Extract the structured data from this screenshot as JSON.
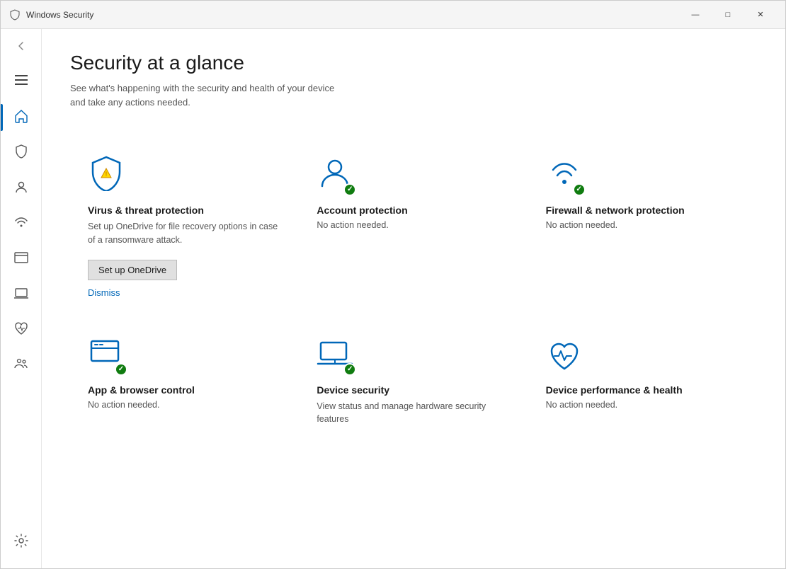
{
  "window": {
    "title": "Windows Security",
    "controls": {
      "minimize": "—",
      "maximize": "□",
      "close": "✕"
    }
  },
  "page": {
    "title": "Security at a glance",
    "subtitle": "See what's happening with the security and health of your device\nand take any actions needed."
  },
  "nav": {
    "items": [
      {
        "id": "home",
        "label": "Home",
        "active": true
      },
      {
        "id": "virus",
        "label": "Virus & threat protection",
        "active": false
      },
      {
        "id": "account",
        "label": "Account protection",
        "active": false
      },
      {
        "id": "firewall",
        "label": "Firewall & network protection",
        "active": false
      },
      {
        "id": "app",
        "label": "App & browser control",
        "active": false
      },
      {
        "id": "device",
        "label": "Device security",
        "active": false
      },
      {
        "id": "health",
        "label": "Device performance & health",
        "active": false
      },
      {
        "id": "family",
        "label": "Family options",
        "active": false
      }
    ],
    "settings_label": "Settings"
  },
  "cards": [
    {
      "id": "virus",
      "title": "Virus & threat protection",
      "description": "Set up OneDrive for file recovery options in case of a ransomware attack.",
      "status": "",
      "has_warning": true,
      "button_label": "Set up OneDrive",
      "dismiss_label": "Dismiss"
    },
    {
      "id": "account",
      "title": "Account protection",
      "description": "",
      "status": "No action needed.",
      "has_warning": false,
      "button_label": "",
      "dismiss_label": ""
    },
    {
      "id": "firewall",
      "title": "Firewall & network protection",
      "description": "",
      "status": "No action needed.",
      "has_warning": false,
      "button_label": "",
      "dismiss_label": ""
    },
    {
      "id": "app",
      "title": "App & browser control",
      "description": "",
      "status": "No action needed.",
      "has_warning": false,
      "button_label": "",
      "dismiss_label": ""
    },
    {
      "id": "devicesec",
      "title": "Device security",
      "description": "View status and manage hardware security features",
      "status": "",
      "has_warning": false,
      "button_label": "",
      "dismiss_label": ""
    },
    {
      "id": "health",
      "title": "Device performance & health",
      "description": "",
      "status": "No action needed.",
      "has_warning": false,
      "button_label": "",
      "dismiss_label": ""
    }
  ]
}
